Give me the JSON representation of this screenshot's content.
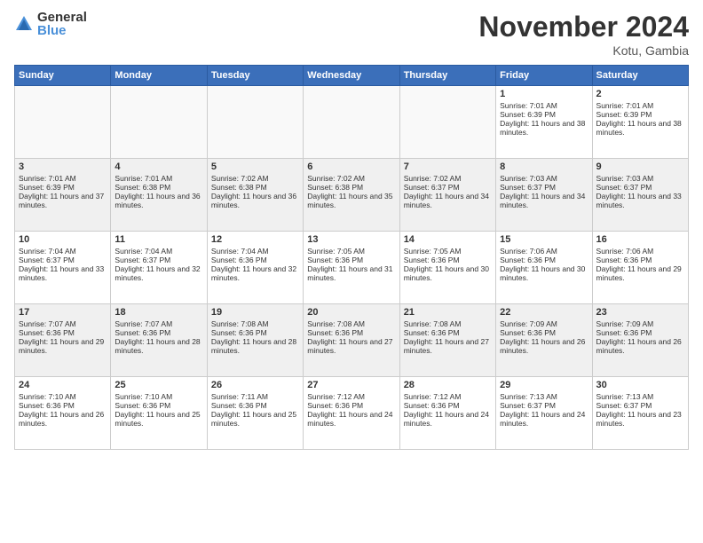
{
  "logo": {
    "general": "General",
    "blue": "Blue"
  },
  "header": {
    "month": "November 2024",
    "location": "Kotu, Gambia"
  },
  "days_of_week": [
    "Sunday",
    "Monday",
    "Tuesday",
    "Wednesday",
    "Thursday",
    "Friday",
    "Saturday"
  ],
  "weeks": [
    [
      {
        "day": "",
        "content": ""
      },
      {
        "day": "",
        "content": ""
      },
      {
        "day": "",
        "content": ""
      },
      {
        "day": "",
        "content": ""
      },
      {
        "day": "",
        "content": ""
      },
      {
        "day": "1",
        "content": "Sunrise: 7:01 AM\nSunset: 6:39 PM\nDaylight: 11 hours and 38 minutes."
      },
      {
        "day": "2",
        "content": "Sunrise: 7:01 AM\nSunset: 6:39 PM\nDaylight: 11 hours and 38 minutes."
      }
    ],
    [
      {
        "day": "3",
        "content": "Sunrise: 7:01 AM\nSunset: 6:39 PM\nDaylight: 11 hours and 37 minutes."
      },
      {
        "day": "4",
        "content": "Sunrise: 7:01 AM\nSunset: 6:38 PM\nDaylight: 11 hours and 36 minutes."
      },
      {
        "day": "5",
        "content": "Sunrise: 7:02 AM\nSunset: 6:38 PM\nDaylight: 11 hours and 36 minutes."
      },
      {
        "day": "6",
        "content": "Sunrise: 7:02 AM\nSunset: 6:38 PM\nDaylight: 11 hours and 35 minutes."
      },
      {
        "day": "7",
        "content": "Sunrise: 7:02 AM\nSunset: 6:37 PM\nDaylight: 11 hours and 34 minutes."
      },
      {
        "day": "8",
        "content": "Sunrise: 7:03 AM\nSunset: 6:37 PM\nDaylight: 11 hours and 34 minutes."
      },
      {
        "day": "9",
        "content": "Sunrise: 7:03 AM\nSunset: 6:37 PM\nDaylight: 11 hours and 33 minutes."
      }
    ],
    [
      {
        "day": "10",
        "content": "Sunrise: 7:04 AM\nSunset: 6:37 PM\nDaylight: 11 hours and 33 minutes."
      },
      {
        "day": "11",
        "content": "Sunrise: 7:04 AM\nSunset: 6:37 PM\nDaylight: 11 hours and 32 minutes."
      },
      {
        "day": "12",
        "content": "Sunrise: 7:04 AM\nSunset: 6:36 PM\nDaylight: 11 hours and 32 minutes."
      },
      {
        "day": "13",
        "content": "Sunrise: 7:05 AM\nSunset: 6:36 PM\nDaylight: 11 hours and 31 minutes."
      },
      {
        "day": "14",
        "content": "Sunrise: 7:05 AM\nSunset: 6:36 PM\nDaylight: 11 hours and 30 minutes."
      },
      {
        "day": "15",
        "content": "Sunrise: 7:06 AM\nSunset: 6:36 PM\nDaylight: 11 hours and 30 minutes."
      },
      {
        "day": "16",
        "content": "Sunrise: 7:06 AM\nSunset: 6:36 PM\nDaylight: 11 hours and 29 minutes."
      }
    ],
    [
      {
        "day": "17",
        "content": "Sunrise: 7:07 AM\nSunset: 6:36 PM\nDaylight: 11 hours and 29 minutes."
      },
      {
        "day": "18",
        "content": "Sunrise: 7:07 AM\nSunset: 6:36 PM\nDaylight: 11 hours and 28 minutes."
      },
      {
        "day": "19",
        "content": "Sunrise: 7:08 AM\nSunset: 6:36 PM\nDaylight: 11 hours and 28 minutes."
      },
      {
        "day": "20",
        "content": "Sunrise: 7:08 AM\nSunset: 6:36 PM\nDaylight: 11 hours and 27 minutes."
      },
      {
        "day": "21",
        "content": "Sunrise: 7:08 AM\nSunset: 6:36 PM\nDaylight: 11 hours and 27 minutes."
      },
      {
        "day": "22",
        "content": "Sunrise: 7:09 AM\nSunset: 6:36 PM\nDaylight: 11 hours and 26 minutes."
      },
      {
        "day": "23",
        "content": "Sunrise: 7:09 AM\nSunset: 6:36 PM\nDaylight: 11 hours and 26 minutes."
      }
    ],
    [
      {
        "day": "24",
        "content": "Sunrise: 7:10 AM\nSunset: 6:36 PM\nDaylight: 11 hours and 26 minutes."
      },
      {
        "day": "25",
        "content": "Sunrise: 7:10 AM\nSunset: 6:36 PM\nDaylight: 11 hours and 25 minutes."
      },
      {
        "day": "26",
        "content": "Sunrise: 7:11 AM\nSunset: 6:36 PM\nDaylight: 11 hours and 25 minutes."
      },
      {
        "day": "27",
        "content": "Sunrise: 7:12 AM\nSunset: 6:36 PM\nDaylight: 11 hours and 24 minutes."
      },
      {
        "day": "28",
        "content": "Sunrise: 7:12 AM\nSunset: 6:36 PM\nDaylight: 11 hours and 24 minutes."
      },
      {
        "day": "29",
        "content": "Sunrise: 7:13 AM\nSunset: 6:37 PM\nDaylight: 11 hours and 24 minutes."
      },
      {
        "day": "30",
        "content": "Sunrise: 7:13 AM\nSunset: 6:37 PM\nDaylight: 11 hours and 23 minutes."
      }
    ]
  ]
}
